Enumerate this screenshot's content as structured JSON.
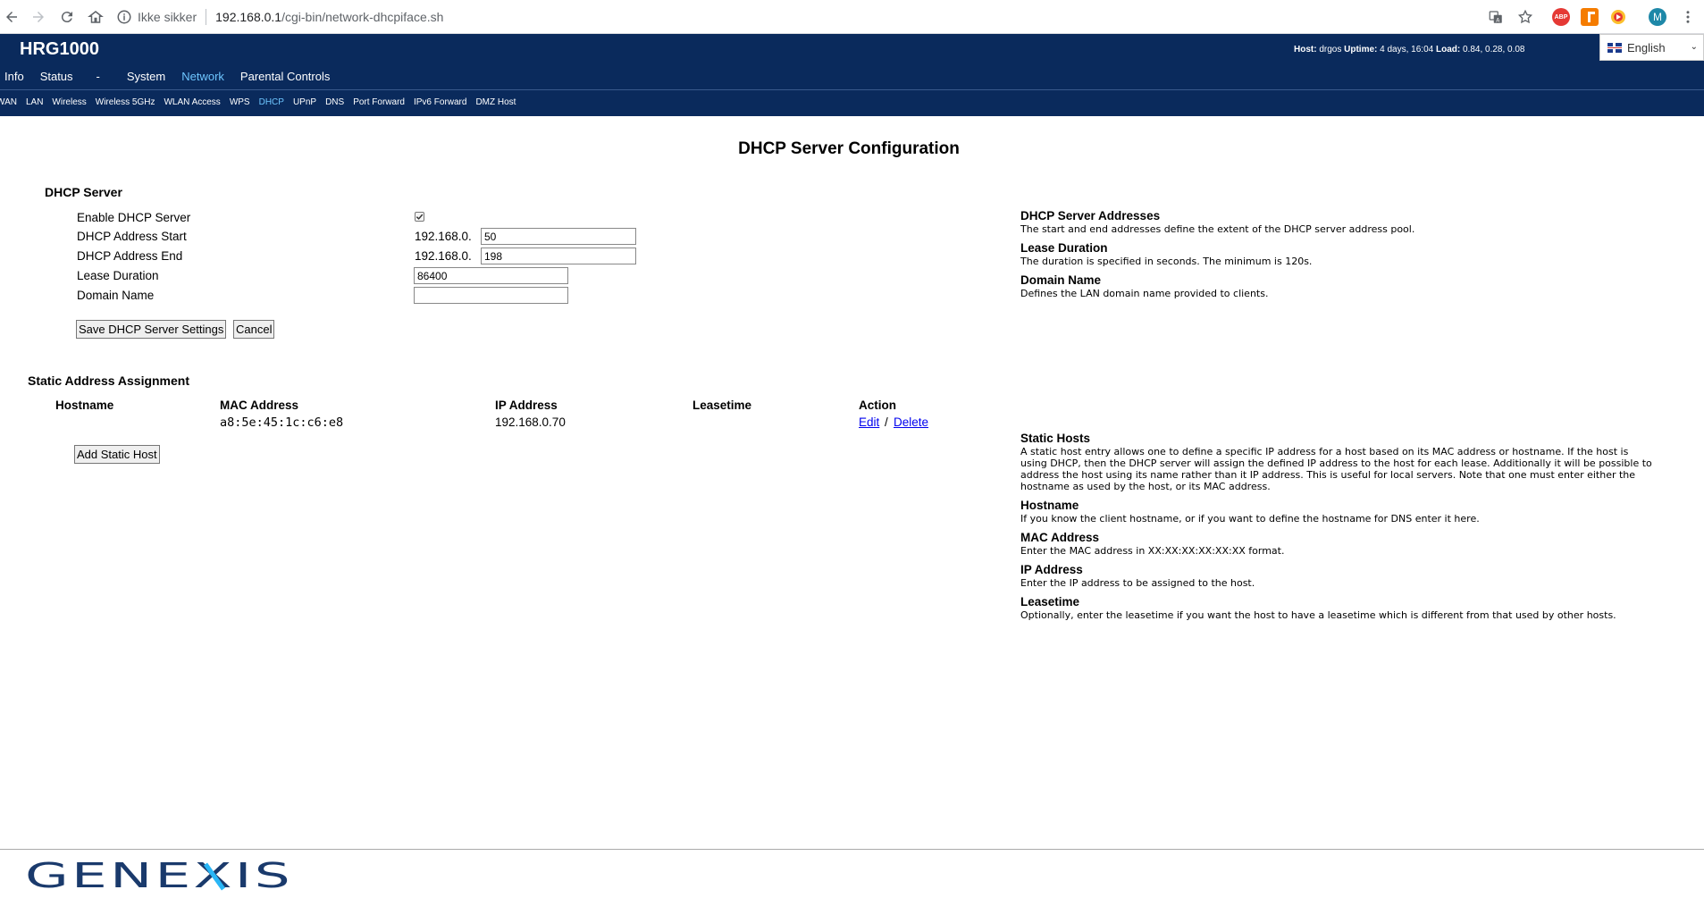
{
  "browser": {
    "security_label": "Ikke sikker",
    "url_host": "192.168.0.1",
    "url_path": "/cgi-bin/network-dhcpiface.sh",
    "avatar_letter": "M",
    "abp_label": "ABP"
  },
  "header": {
    "brand": "HRG1000",
    "host_label": "Host:",
    "host_value": "drgos",
    "uptime_label": "Uptime:",
    "uptime_value": "4 days, 16:04",
    "load_label": "Load:",
    "load_value": "0.84, 0.28, 0.08",
    "language": "English"
  },
  "main_menu": [
    {
      "label": "Info",
      "active": false
    },
    {
      "label": "Status",
      "active": false
    },
    {
      "label": "-",
      "active": false
    },
    {
      "label": "System",
      "active": false
    },
    {
      "label": "Network",
      "active": true
    },
    {
      "label": "Parental Controls",
      "active": false
    }
  ],
  "sub_menu": [
    {
      "label": "WAN",
      "active": false
    },
    {
      "label": "LAN",
      "active": false
    },
    {
      "label": "Wireless",
      "active": false
    },
    {
      "label": "Wireless 5GHz",
      "active": false
    },
    {
      "label": "WLAN Access",
      "active": false
    },
    {
      "label": "WPS",
      "active": false
    },
    {
      "label": "DHCP",
      "active": true
    },
    {
      "label": "UPnP",
      "active": false
    },
    {
      "label": "DNS",
      "active": false
    },
    {
      "label": "Port Forward",
      "active": false
    },
    {
      "label": "IPv6 Forward",
      "active": false
    },
    {
      "label": "DMZ Host",
      "active": false
    }
  ],
  "page_title": "DHCP Server Configuration",
  "dhcp_server": {
    "title": "DHCP Server",
    "enable_label": "Enable DHCP Server",
    "enabled": true,
    "start_label": "DHCP Address Start",
    "start_prefix": "192.168.0.",
    "start_value": "50",
    "end_label": "DHCP Address End",
    "end_prefix": "192.168.0.",
    "end_value": "198",
    "lease_label": "Lease Duration",
    "lease_value": "86400",
    "domain_label": "Domain Name",
    "domain_value": "",
    "save_button": "Save DHCP Server Settings",
    "cancel_button": "Cancel"
  },
  "static": {
    "title": "Static Address Assignment",
    "columns": {
      "hostname": "Hostname",
      "mac": "MAC Address",
      "ip": "IP Address",
      "leasetime": "Leasetime",
      "action": "Action"
    },
    "rows": [
      {
        "hostname": "",
        "mac": "a8:5e:45:1c:c6:e8",
        "ip": "192.168.0.70",
        "leasetime": "",
        "edit": "Edit",
        "slash": "/",
        "delete": "Delete"
      }
    ],
    "add_button": "Add Static Host"
  },
  "help_top": [
    {
      "title": "DHCP Server Addresses",
      "text": "The start and end addresses define the extent of the DHCP server address pool."
    },
    {
      "title": "Lease Duration",
      "text": "The duration is specified in seconds. The minimum is 120s."
    },
    {
      "title": "Domain Name",
      "text": "Defines the LAN domain name provided to clients."
    }
  ],
  "help_bottom": [
    {
      "title": "Static Hosts",
      "text": "A static host entry allows one to define a specific IP address for a host based on its MAC address or hostname. If the host is using DHCP, then the DHCP server will assign the defined IP address to the host for each lease. Additionally it will be possible to address the host using its name rather than it IP address. This is useful for local servers. Note that one must enter either the hostname as used by the host, or its MAC address."
    },
    {
      "title": "Hostname",
      "text": "If you know the client hostname, or if you want to define the hostname for DNS enter it here."
    },
    {
      "title": "MAC Address",
      "text": "Enter the MAC address in XX:XX:XX:XX:XX:XX format."
    },
    {
      "title": "IP Address",
      "text": "Enter the IP address to be assigned to the host."
    },
    {
      "title": "Leasetime",
      "text": "Optionally, enter the leasetime if you want the host to have a leasetime which is different from that used by other hosts."
    }
  ],
  "footer": {
    "logo_text": "GENEXIS"
  },
  "colors": {
    "header_bg": "#0a2a5c",
    "active_menu": "#6ec6ff",
    "link": "#0000ee"
  }
}
